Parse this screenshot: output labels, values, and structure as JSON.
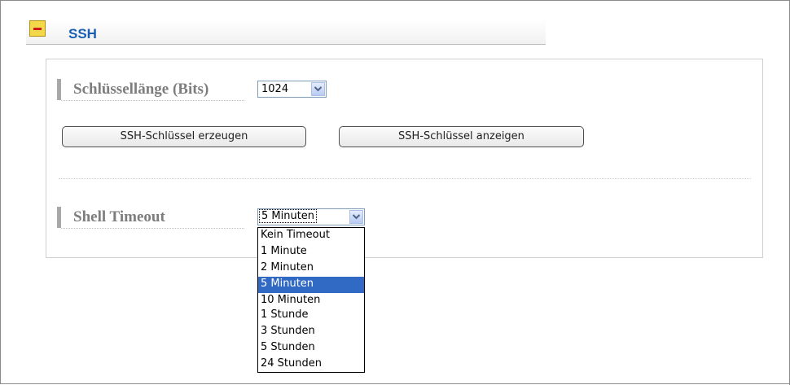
{
  "section": {
    "title": "SSH",
    "collapse_icon": "minus-icon"
  },
  "key_length": {
    "label": "Schlüssellänge (Bits)",
    "value": "1024"
  },
  "buttons": {
    "generate": "SSH-Schlüssel erzeugen",
    "show": "SSH-Schlüssel anzeigen"
  },
  "shell_timeout": {
    "label": "Shell Timeout",
    "value": "5 Minuten",
    "options": [
      "Kein Timeout",
      "1 Minute",
      "2 Minuten",
      "5 Minuten",
      "10 Minuten",
      "1 Stunde",
      "3 Stunden",
      "5 Stunden",
      "24 Stunden"
    ],
    "selected_index": 3
  },
  "colors": {
    "title": "#1a5fb4",
    "selection": "#316ac5",
    "label": "#7d7d7d"
  }
}
